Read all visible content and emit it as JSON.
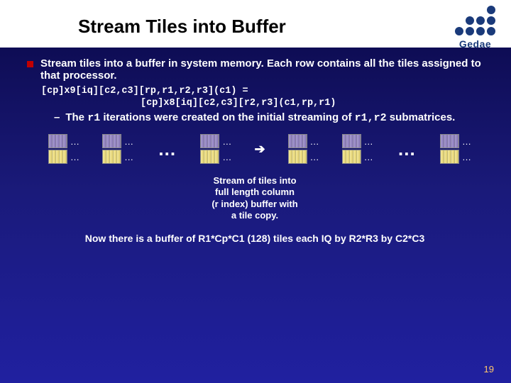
{
  "title": "Stream Tiles into Buffer",
  "logo_text": "Gedae",
  "bullet_main": "Stream tiles into a buffer in system memory. Each row contains all the tiles assigned to that processor.",
  "code_line1": "[cp]x9[iq][c2,c3][rp,r1,r2,r3](c1) =",
  "code_line2": "[cp]x8[iq][c2,c3][r2,r3](c1,rp,r1)",
  "sub_dash": "–",
  "sub_bullet_pre": "The ",
  "sub_bullet_r1a": "r1",
  "sub_bullet_mid": " iterations were created on the initial streaming of ",
  "sub_bullet_r1r2": "r1,r2",
  "sub_bullet_post": " submatrices.",
  "tile_ellipsis": "…",
  "big_ellipsis": "…",
  "arrow": "➔",
  "caption_l1": "Stream of tiles into",
  "caption_l2": "full length column",
  "caption_l3": "(r index) buffer with",
  "caption_l4": "a tile copy.",
  "footer": "Now there is a buffer of R1*Cp*C1 (128) tiles each  IQ by R2*R3 by C2*C3",
  "page": "19"
}
